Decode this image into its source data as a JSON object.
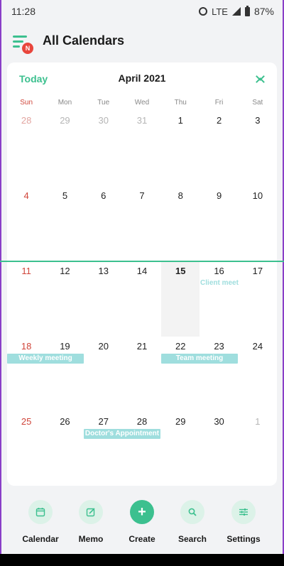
{
  "status_bar": {
    "time": "11:28",
    "network": "LTE",
    "battery": "87%"
  },
  "header": {
    "menu_badge": "N",
    "title": "All Calendars"
  },
  "month_header": {
    "today_label": "Today",
    "month_title": "April 2021"
  },
  "weekdays": [
    "Sun",
    "Mon",
    "Tue",
    "Wed",
    "Thu",
    "Fri",
    "Sat"
  ],
  "weeks": [
    [
      {
        "d": "28",
        "m": true
      },
      {
        "d": "29",
        "m": true
      },
      {
        "d": "30",
        "m": true
      },
      {
        "d": "31",
        "m": true
      },
      {
        "d": "1"
      },
      {
        "d": "2"
      },
      {
        "d": "3"
      }
    ],
    [
      {
        "d": "4"
      },
      {
        "d": "5"
      },
      {
        "d": "6"
      },
      {
        "d": "7"
      },
      {
        "d": "8"
      },
      {
        "d": "9"
      },
      {
        "d": "10"
      }
    ],
    [
      {
        "d": "11"
      },
      {
        "d": "12"
      },
      {
        "d": "13"
      },
      {
        "d": "14"
      },
      {
        "d": "15",
        "today": true
      },
      {
        "d": "16"
      },
      {
        "d": "17"
      }
    ],
    [
      {
        "d": "18"
      },
      {
        "d": "19"
      },
      {
        "d": "20"
      },
      {
        "d": "21"
      },
      {
        "d": "22"
      },
      {
        "d": "23"
      },
      {
        "d": "24"
      }
    ],
    [
      {
        "d": "25"
      },
      {
        "d": "26"
      },
      {
        "d": "27"
      },
      {
        "d": "28"
      },
      {
        "d": "29"
      },
      {
        "d": "30"
      },
      {
        "d": "1",
        "m": true
      }
    ]
  ],
  "events": {
    "client_meet": "Client meet",
    "weekly_meeting": "Weekly meeting",
    "team_meeting": "Team meeting",
    "doctors_appointment": "Doctor's Appointment"
  },
  "bottom_nav": {
    "calendar": "Calendar",
    "memo": "Memo",
    "create": "Create",
    "search": "Search",
    "settings": "Settings"
  },
  "colors": {
    "accent": "#3cc08f",
    "event": "#9fdede",
    "sunday": "#d0453a",
    "badge": "#e8453c"
  }
}
